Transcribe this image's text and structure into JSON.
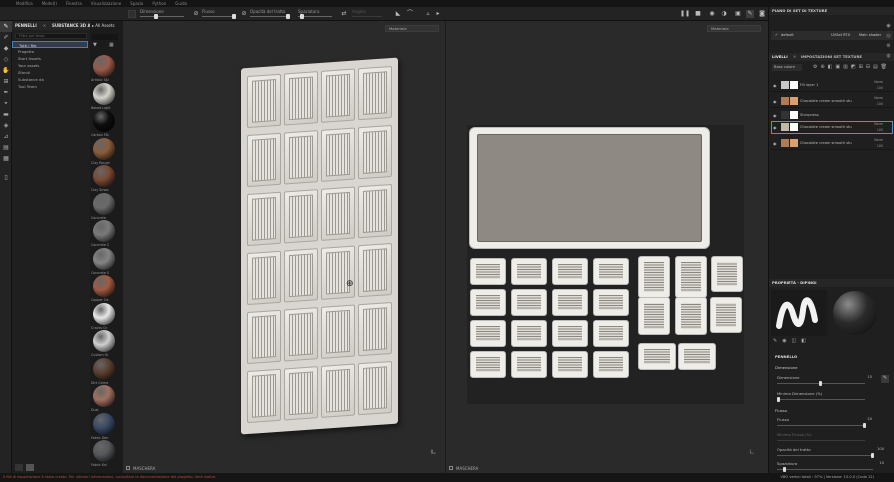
{
  "menubar": {
    "items": [
      "Modifica",
      "Mode(I)",
      "Finestra",
      "Visualizzazione",
      "Spazio",
      "Python",
      "Guida"
    ]
  },
  "toolbar": {
    "size_label": "Dimensione",
    "flow_label": "Flusso",
    "opacity_label": "Opacità del tratto",
    "spacing_label": "Spaziatura",
    "angle_label": "Angolo"
  },
  "assets": {
    "tab1": "PENNELLI",
    "tab2": "SUBSTANCE 3D ASSETS",
    "search_placeholder": "Filtra per testo",
    "tree": [
      "Tutti i file",
      "Progetto",
      "Start Assets",
      "Your assets",
      "Sfondi",
      "Substance da",
      "Tuoi Team"
    ],
    "all_assets": "All Assets",
    "materials": [
      {
        "name": "Artistic Ski",
        "color": "#9a5a4a"
      },
      {
        "name": "Baked Light",
        "color": "#d6d3cc"
      },
      {
        "name": "Carbon Fib",
        "color": "#0d0d0d"
      },
      {
        "name": "Clay Rough",
        "color": "#8a5b3b"
      },
      {
        "name": "Clay Smoo",
        "color": "#7a4a35"
      },
      {
        "name": "Concrete",
        "color": "#6a6a6a"
      },
      {
        "name": "Concrete C",
        "color": "#7a7a7a"
      },
      {
        "name": "Concrete S",
        "color": "#848484"
      },
      {
        "name": "Copper Ox",
        "color": "#a05a40"
      },
      {
        "name": "Cracks Gr",
        "color": "#e8e8e8"
      },
      {
        "name": "Custom Gr",
        "color": "#cfcfcf"
      },
      {
        "name": "Dirt Grime",
        "color": "#5b4030"
      },
      {
        "name": "Dust",
        "color": "#a07060"
      },
      {
        "name": "Fabric Den",
        "color": "#3a4a66"
      },
      {
        "name": "Fabric Kni",
        "color": "#55575a"
      }
    ]
  },
  "viewport3d": {
    "dropdown": "Materiale",
    "footer": "MASCHERA"
  },
  "viewportuv": {
    "dropdown": "Materiale",
    "footer": "MASCHERA"
  },
  "rightpanel": {
    "title": "PIANO DI SET DI TEXTURE",
    "set_label": "default",
    "set_info": "UVSet RTX",
    "set_shader": "Main shader",
    "tab_layers": "LIVELLI",
    "tab_settings": "IMPOSTAZIONI SET TEXTURE",
    "channel": "Base colore",
    "layers": [
      {
        "name": "Fill layer 1",
        "blend": "Norm",
        "value": "100",
        "thumb": "#c8c8c8",
        "thumb2": "#ffffff"
      },
      {
        "name": "Chocolate cream smooth stu",
        "blend": "Norm",
        "value": "100",
        "thumb": "#b07a55",
        "thumb2": "#d9a070"
      },
      {
        "name": "Sharpness",
        "blend": "",
        "value": "",
        "thumb": "#333333",
        "thumb2": "#ffffff"
      },
      {
        "name": "Chocolate cream smooth stu",
        "blend": "Norm",
        "value": "100",
        "thumb": "#c2b7a8",
        "thumb2": "#ffffff"
      },
      {
        "name": "Chocolate cream smooth stu",
        "blend": "Norm",
        "value": "100",
        "thumb": "#b07a55",
        "thumb2": "#d9a070"
      }
    ],
    "props_title": "PROPRIETÀ - DIPINGI",
    "section_brush": "PENNELLO",
    "section_dim": "Dimensione",
    "size_label": "Dimensione",
    "size_value": "15",
    "min_size_label": "Minima Dimensione (%)",
    "flow_section": "Flusso",
    "flow_label": "Flusso",
    "flow_value": "20",
    "min_flow_label": "Minimo Flusso (%)",
    "opacity_label": "Opacità del tratto",
    "opacity_value": "100",
    "spacing_label": "Spaziatura",
    "spacing_value": "10"
  },
  "statusbar": {
    "message": "Il file di esportazione è stato creato. Per ulteriori informazioni, consultare la documentazione del progetto. Vedi inoltre.",
    "right": "VBO vertici totali : 97% | Versione: 10.0.0 (Cuda 12)"
  }
}
